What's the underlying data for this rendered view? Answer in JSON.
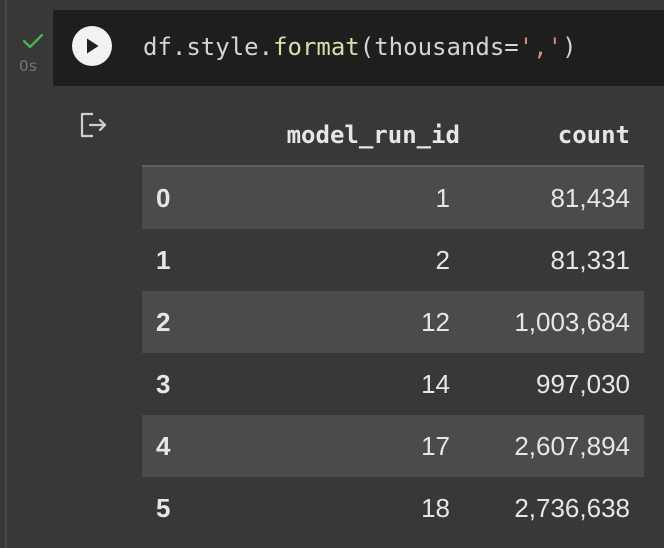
{
  "cell": {
    "status_icon": "check-icon",
    "exec_time": "0s",
    "run_icon": "play-icon",
    "code": {
      "object": "df",
      "dot1": ".",
      "attr": "style",
      "dot2": ".",
      "method": "format",
      "open_paren": "(",
      "kwarg": "thousands",
      "equals": "=",
      "string": "','",
      "close_paren": ")"
    }
  },
  "output": {
    "output_icon": "output-redirect-icon",
    "table": {
      "columns": [
        "",
        "model_run_id",
        "count"
      ],
      "rows": [
        {
          "index": "0",
          "model_run_id": "1",
          "count": "81,434"
        },
        {
          "index": "1",
          "model_run_id": "2",
          "count": "81,331"
        },
        {
          "index": "2",
          "model_run_id": "12",
          "count": "1,003,684"
        },
        {
          "index": "3",
          "model_run_id": "14",
          "count": "997,030"
        },
        {
          "index": "4",
          "model_run_id": "17",
          "count": "2,607,894"
        },
        {
          "index": "5",
          "model_run_id": "18",
          "count": "2,736,638"
        }
      ]
    }
  },
  "colors": {
    "background": "#383838",
    "code_background": "#1e1e1e",
    "check": "#4caf50",
    "method": "#dcdcaa",
    "string": "#ce9178",
    "striped_row": "#4b4b4b"
  }
}
